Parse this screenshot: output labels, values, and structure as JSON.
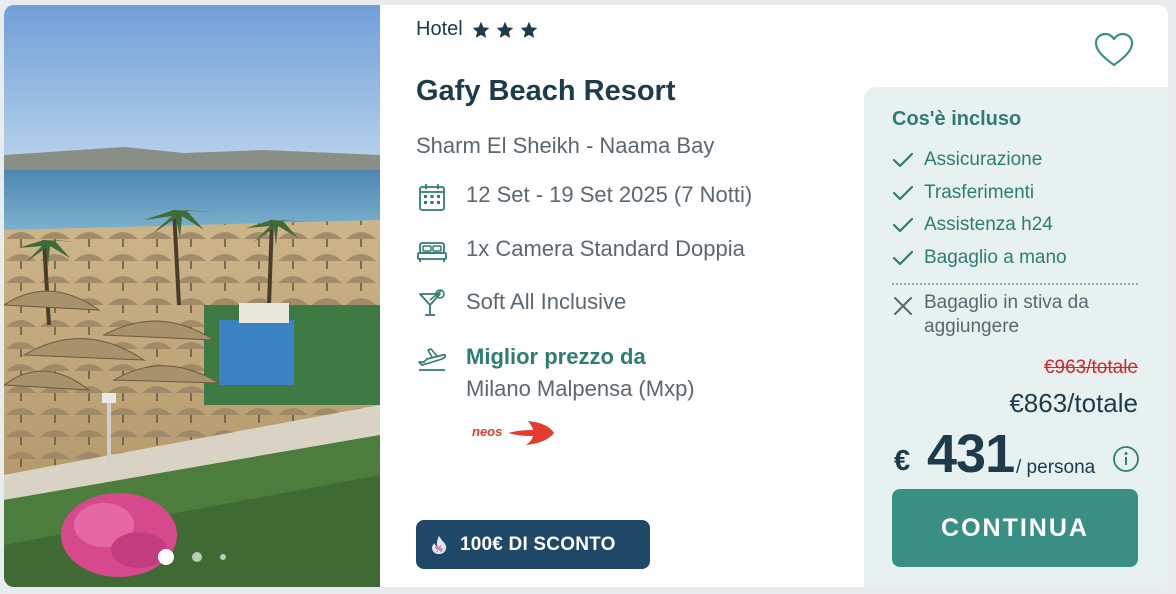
{
  "photo": {
    "alt_icon": "beach-resort-photo",
    "carousel_dots": 3,
    "active_dot": 1
  },
  "hotel": {
    "type_label": "Hotel",
    "stars": 3,
    "name": "Gafy Beach Resort",
    "location": "Sharm El Sheikh - Naama Bay"
  },
  "details": {
    "dates": "12 Set - 19 Set 2025 (7 Notti)",
    "room": "1x Camera Standard Doppia",
    "board": "Soft All Inclusive",
    "flight_title": "Miglior prezzo da",
    "flight_origin": "Milano Malpensa (Mxp)",
    "airline_logo_text": "neos"
  },
  "discount_badge": {
    "label": "100€ DI SCONTO"
  },
  "included": {
    "title": "Cos'è incluso",
    "items": [
      "Assicurazione",
      "Trasferimenti",
      "Assistenza h24",
      "Bagaglio a mano"
    ],
    "excluded": "Bagaglio in stiva da aggiungere"
  },
  "pricing": {
    "old_total": "€963/totale",
    "total": "€863/totale",
    "currency_symbol": "€",
    "per_person_value": "431",
    "per_person_unit": "/ persona"
  },
  "cta": {
    "label": "CONTINUA"
  },
  "colors": {
    "brand_dark": "#1d3b4a",
    "accent_green": "#2f7d72",
    "button_green": "#3a8f84",
    "badge_navy": "#1e4768",
    "panel_bg": "#e6f1f0",
    "strike_red": "#d8242b"
  }
}
